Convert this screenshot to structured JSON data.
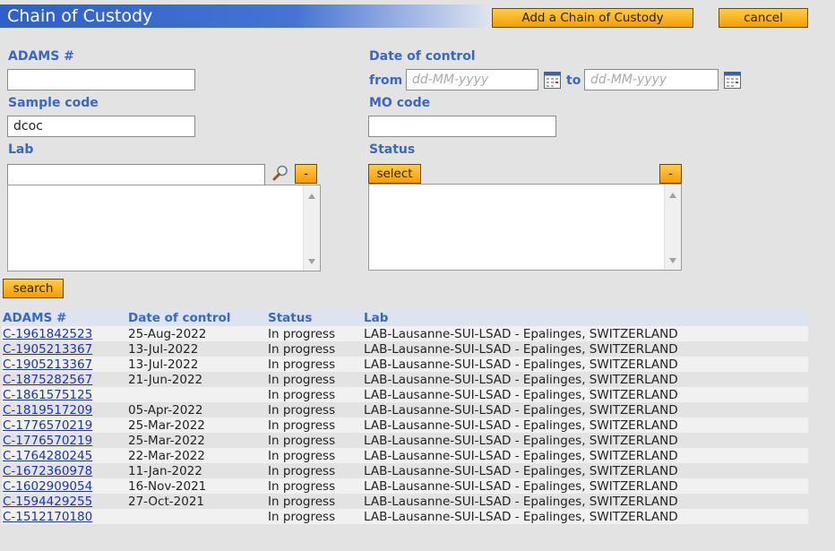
{
  "header": {
    "title": "Chain of Custody",
    "add_label": "Add a Chain of Custody",
    "cancel_label": "cancel"
  },
  "form": {
    "adams_label": "ADAMS #",
    "adams_value": "",
    "date_label": "Date of control",
    "from_label": "from",
    "to_label": "to",
    "date_placeholder": "dd-MM-yyyy",
    "sample_label": "Sample code",
    "sample_value": "dcoc",
    "mo_label": "MO code",
    "mo_value": "",
    "lab_label": "Lab",
    "lab_value": "",
    "lab_remove": "-",
    "status_label": "Status",
    "status_select": "select",
    "status_remove": "-",
    "search_label": "search"
  },
  "table": {
    "columns": [
      "ADAMS #",
      "Date of control",
      "Status",
      "Lab"
    ],
    "rows": [
      [
        "C-1961842523",
        "25-Aug-2022",
        "In progress",
        "LAB-Lausanne-SUI-LSAD - Epalinges, SWITZERLAND"
      ],
      [
        "C-1905213367",
        "13-Jul-2022",
        "In progress",
        "LAB-Lausanne-SUI-LSAD - Epalinges, SWITZERLAND"
      ],
      [
        "C-1905213367",
        "13-Jul-2022",
        "In progress",
        "LAB-Lausanne-SUI-LSAD - Epalinges, SWITZERLAND"
      ],
      [
        "C-1875282567",
        "21-Jun-2022",
        "In progress",
        "LAB-Lausanne-SUI-LSAD - Epalinges, SWITZERLAND"
      ],
      [
        "C-1861575125",
        "",
        "In progress",
        "LAB-Lausanne-SUI-LSAD - Epalinges, SWITZERLAND"
      ],
      [
        "C-1819517209",
        "05-Apr-2022",
        "In progress",
        "LAB-Lausanne-SUI-LSAD - Epalinges, SWITZERLAND"
      ],
      [
        "C-1776570219",
        "25-Mar-2022",
        "In progress",
        "LAB-Lausanne-SUI-LSAD - Epalinges, SWITZERLAND"
      ],
      [
        "C-1776570219",
        "25-Mar-2022",
        "In progress",
        "LAB-Lausanne-SUI-LSAD - Epalinges, SWITZERLAND"
      ],
      [
        "C-1764280245",
        "22-Mar-2022",
        "In progress",
        "LAB-Lausanne-SUI-LSAD - Epalinges, SWITZERLAND"
      ],
      [
        "C-1672360978",
        "11-Jan-2022",
        "In progress",
        "LAB-Lausanne-SUI-LSAD - Epalinges, SWITZERLAND"
      ],
      [
        "C-1602909054",
        "16-Nov-2021",
        "In progress",
        "LAB-Lausanne-SUI-LSAD - Epalinges, SWITZERLAND"
      ],
      [
        "C-1594429255",
        "27-Oct-2021",
        "In progress",
        "LAB-Lausanne-SUI-LSAD - Epalinges, SWITZERLAND"
      ],
      [
        "C-1512170180",
        "",
        "In progress",
        "LAB-Lausanne-SUI-LSAD - Epalinges, SWITZERLAND"
      ]
    ]
  },
  "icons": {
    "calendar": "calendar-icon",
    "search": "magnifier-icon"
  },
  "colors": {
    "title_bar": "#2f5fc8",
    "button": "#f5a800",
    "label": "#3a67c4",
    "link": "#1a33b8"
  }
}
